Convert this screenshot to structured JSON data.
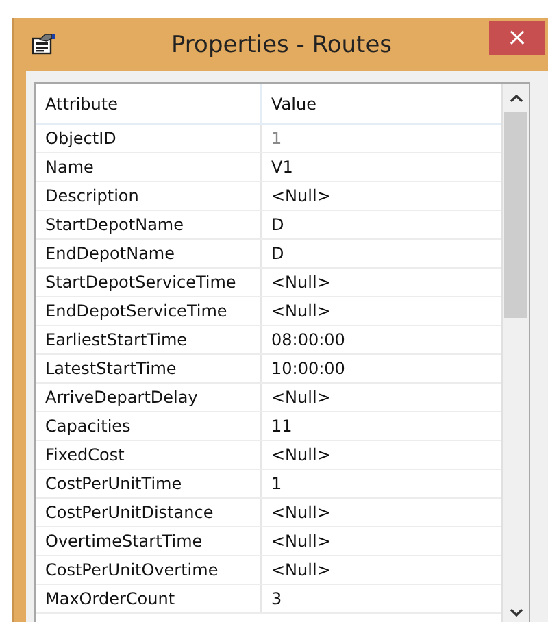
{
  "window": {
    "title": "Properties - Routes",
    "close": "×"
  },
  "table": {
    "columns": [
      "Attribute",
      "Value"
    ],
    "rows": [
      {
        "attribute": "ObjectID",
        "value": "1",
        "disabled": true
      },
      {
        "attribute": "Name",
        "value": "V1",
        "disabled": false
      },
      {
        "attribute": "Description",
        "value": "<Null>",
        "disabled": false
      },
      {
        "attribute": "StartDepotName",
        "value": "D",
        "disabled": false
      },
      {
        "attribute": "EndDepotName",
        "value": "D",
        "disabled": false
      },
      {
        "attribute": "StartDepotServiceTime",
        "value": "<Null>",
        "disabled": false
      },
      {
        "attribute": "EndDepotServiceTime",
        "value": "<Null>",
        "disabled": false
      },
      {
        "attribute": "EarliestStartTime",
        "value": "08:00:00",
        "disabled": false
      },
      {
        "attribute": "LatestStartTime",
        "value": "10:00:00",
        "disabled": false
      },
      {
        "attribute": "ArriveDepartDelay",
        "value": "<Null>",
        "disabled": false
      },
      {
        "attribute": "Capacities",
        "value": "11",
        "disabled": false
      },
      {
        "attribute": "FixedCost",
        "value": "<Null>",
        "disabled": false
      },
      {
        "attribute": "CostPerUnitTime",
        "value": "1",
        "disabled": false
      },
      {
        "attribute": "CostPerUnitDistance",
        "value": "<Null>",
        "disabled": false
      },
      {
        "attribute": "OvertimeStartTime",
        "value": "<Null>",
        "disabled": false
      },
      {
        "attribute": "CostPerUnitOvertime",
        "value": "<Null>",
        "disabled": false
      },
      {
        "attribute": "MaxOrderCount",
        "value": "3",
        "disabled": false
      }
    ]
  }
}
